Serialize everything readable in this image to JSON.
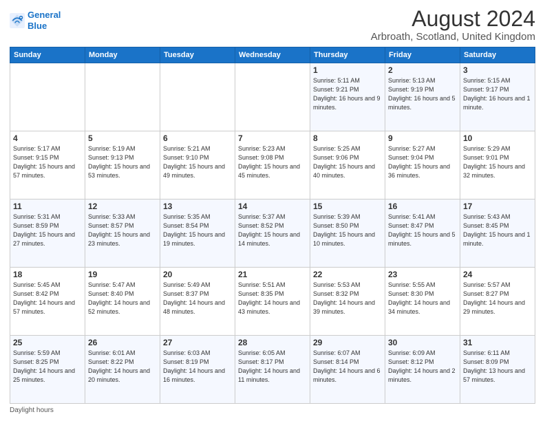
{
  "header": {
    "logo_line1": "General",
    "logo_line2": "Blue",
    "main_title": "August 2024",
    "subtitle": "Arbroath, Scotland, United Kingdom"
  },
  "calendar": {
    "days_of_week": [
      "Sunday",
      "Monday",
      "Tuesday",
      "Wednesday",
      "Thursday",
      "Friday",
      "Saturday"
    ],
    "weeks": [
      [
        {
          "day": "",
          "detail": ""
        },
        {
          "day": "",
          "detail": ""
        },
        {
          "day": "",
          "detail": ""
        },
        {
          "day": "",
          "detail": ""
        },
        {
          "day": "1",
          "detail": "Sunrise: 5:11 AM\nSunset: 9:21 PM\nDaylight: 16 hours\nand 9 minutes."
        },
        {
          "day": "2",
          "detail": "Sunrise: 5:13 AM\nSunset: 9:19 PM\nDaylight: 16 hours\nand 5 minutes."
        },
        {
          "day": "3",
          "detail": "Sunrise: 5:15 AM\nSunset: 9:17 PM\nDaylight: 16 hours\nand 1 minute."
        }
      ],
      [
        {
          "day": "4",
          "detail": "Sunrise: 5:17 AM\nSunset: 9:15 PM\nDaylight: 15 hours\nand 57 minutes."
        },
        {
          "day": "5",
          "detail": "Sunrise: 5:19 AM\nSunset: 9:13 PM\nDaylight: 15 hours\nand 53 minutes."
        },
        {
          "day": "6",
          "detail": "Sunrise: 5:21 AM\nSunset: 9:10 PM\nDaylight: 15 hours\nand 49 minutes."
        },
        {
          "day": "7",
          "detail": "Sunrise: 5:23 AM\nSunset: 9:08 PM\nDaylight: 15 hours\nand 45 minutes."
        },
        {
          "day": "8",
          "detail": "Sunrise: 5:25 AM\nSunset: 9:06 PM\nDaylight: 15 hours\nand 40 minutes."
        },
        {
          "day": "9",
          "detail": "Sunrise: 5:27 AM\nSunset: 9:04 PM\nDaylight: 15 hours\nand 36 minutes."
        },
        {
          "day": "10",
          "detail": "Sunrise: 5:29 AM\nSunset: 9:01 PM\nDaylight: 15 hours\nand 32 minutes."
        }
      ],
      [
        {
          "day": "11",
          "detail": "Sunrise: 5:31 AM\nSunset: 8:59 PM\nDaylight: 15 hours\nand 27 minutes."
        },
        {
          "day": "12",
          "detail": "Sunrise: 5:33 AM\nSunset: 8:57 PM\nDaylight: 15 hours\nand 23 minutes."
        },
        {
          "day": "13",
          "detail": "Sunrise: 5:35 AM\nSunset: 8:54 PM\nDaylight: 15 hours\nand 19 minutes."
        },
        {
          "day": "14",
          "detail": "Sunrise: 5:37 AM\nSunset: 8:52 PM\nDaylight: 15 hours\nand 14 minutes."
        },
        {
          "day": "15",
          "detail": "Sunrise: 5:39 AM\nSunset: 8:50 PM\nDaylight: 15 hours\nand 10 minutes."
        },
        {
          "day": "16",
          "detail": "Sunrise: 5:41 AM\nSunset: 8:47 PM\nDaylight: 15 hours\nand 5 minutes."
        },
        {
          "day": "17",
          "detail": "Sunrise: 5:43 AM\nSunset: 8:45 PM\nDaylight: 15 hours\nand 1 minute."
        }
      ],
      [
        {
          "day": "18",
          "detail": "Sunrise: 5:45 AM\nSunset: 8:42 PM\nDaylight: 14 hours\nand 57 minutes."
        },
        {
          "day": "19",
          "detail": "Sunrise: 5:47 AM\nSunset: 8:40 PM\nDaylight: 14 hours\nand 52 minutes."
        },
        {
          "day": "20",
          "detail": "Sunrise: 5:49 AM\nSunset: 8:37 PM\nDaylight: 14 hours\nand 48 minutes."
        },
        {
          "day": "21",
          "detail": "Sunrise: 5:51 AM\nSunset: 8:35 PM\nDaylight: 14 hours\nand 43 minutes."
        },
        {
          "day": "22",
          "detail": "Sunrise: 5:53 AM\nSunset: 8:32 PM\nDaylight: 14 hours\nand 39 minutes."
        },
        {
          "day": "23",
          "detail": "Sunrise: 5:55 AM\nSunset: 8:30 PM\nDaylight: 14 hours\nand 34 minutes."
        },
        {
          "day": "24",
          "detail": "Sunrise: 5:57 AM\nSunset: 8:27 PM\nDaylight: 14 hours\nand 29 minutes."
        }
      ],
      [
        {
          "day": "25",
          "detail": "Sunrise: 5:59 AM\nSunset: 8:25 PM\nDaylight: 14 hours\nand 25 minutes."
        },
        {
          "day": "26",
          "detail": "Sunrise: 6:01 AM\nSunset: 8:22 PM\nDaylight: 14 hours\nand 20 minutes."
        },
        {
          "day": "27",
          "detail": "Sunrise: 6:03 AM\nSunset: 8:19 PM\nDaylight: 14 hours\nand 16 minutes."
        },
        {
          "day": "28",
          "detail": "Sunrise: 6:05 AM\nSunset: 8:17 PM\nDaylight: 14 hours\nand 11 minutes."
        },
        {
          "day": "29",
          "detail": "Sunrise: 6:07 AM\nSunset: 8:14 PM\nDaylight: 14 hours\nand 6 minutes."
        },
        {
          "day": "30",
          "detail": "Sunrise: 6:09 AM\nSunset: 8:12 PM\nDaylight: 14 hours\nand 2 minutes."
        },
        {
          "day": "31",
          "detail": "Sunrise: 6:11 AM\nSunset: 8:09 PM\nDaylight: 13 hours\nand 57 minutes."
        }
      ]
    ]
  },
  "footer": {
    "note": "Daylight hours"
  }
}
